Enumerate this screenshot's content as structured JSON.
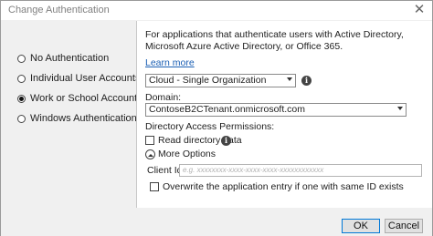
{
  "window": {
    "title": "Change Authentication",
    "close_glyph": "✕"
  },
  "auth_options": [
    {
      "label": "No Authentication",
      "selected": false
    },
    {
      "label": "Individual User Accounts",
      "selected": false
    },
    {
      "label": "Work or School Accounts",
      "selected": true
    },
    {
      "label": "Windows Authentication",
      "selected": false
    }
  ],
  "description": "For applications that authenticate users with Active Directory, Microsoft Azure Active Directory, or Office 365.",
  "learn_more": "Learn more",
  "org_type": {
    "selected": "Cloud - Single Organization"
  },
  "domain": {
    "label": "Domain:",
    "value": "ContoseB2CTenant.onmicrosoft.com"
  },
  "permissions": {
    "label": "Directory Access Permissions:",
    "read_directory_label": "Read directory data",
    "read_directory_checked": false
  },
  "more_options": "More Options",
  "client_id": {
    "label": "Client Id:",
    "placeholder": "e.g. xxxxxxxx-xxxx-xxxx-xxxx-xxxxxxxxxxxx"
  },
  "overwrite": {
    "label": "Overwrite the application entry if one with same ID exists",
    "checked": false
  },
  "buttons": {
    "ok": "OK",
    "cancel": "Cancel"
  },
  "icons": {
    "info": "info-icon",
    "dropdown": "chevron-down-icon",
    "collapse": "chevron-up-circle-icon",
    "close": "close-icon"
  }
}
